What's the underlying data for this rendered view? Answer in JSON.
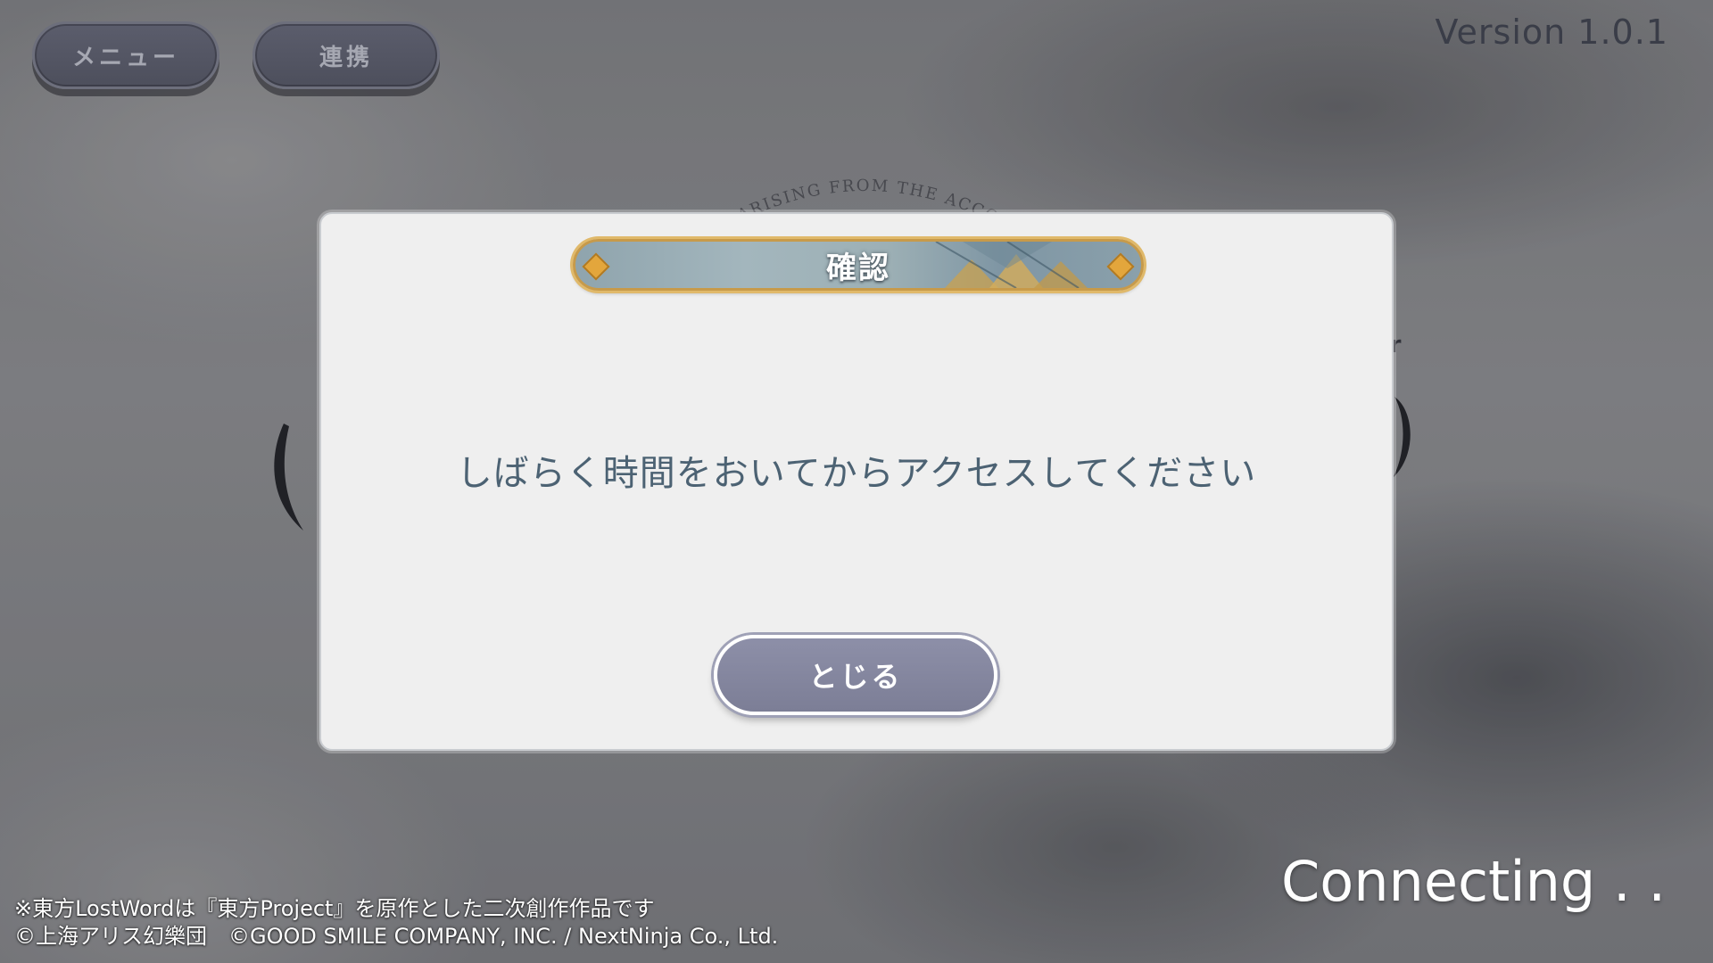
{
  "header": {
    "menu_label": "メニュー",
    "link_label": "連携",
    "version": "Version 1.0.1"
  },
  "background": {
    "emblem_text": "ARISING FROM THE ACCORD O",
    "partial_text_right": "er"
  },
  "dialog": {
    "title": "確認",
    "message": "しばらく時間をおいてからアクセスしてください",
    "close_label": "とじる"
  },
  "status": {
    "connecting": "Connecting . ."
  },
  "footer": {
    "line1": "※東方LostWordは『東方Project』を原作とした二次創作作品です",
    "line2": "©上海アリス幻樂団　©GOOD SMILE COMPANY, INC. / NextNinja Co., Ltd."
  },
  "colors": {
    "accent_gold": "#e0b96a",
    "button_slate": "#7c7e96",
    "message_text": "#4c6273"
  }
}
